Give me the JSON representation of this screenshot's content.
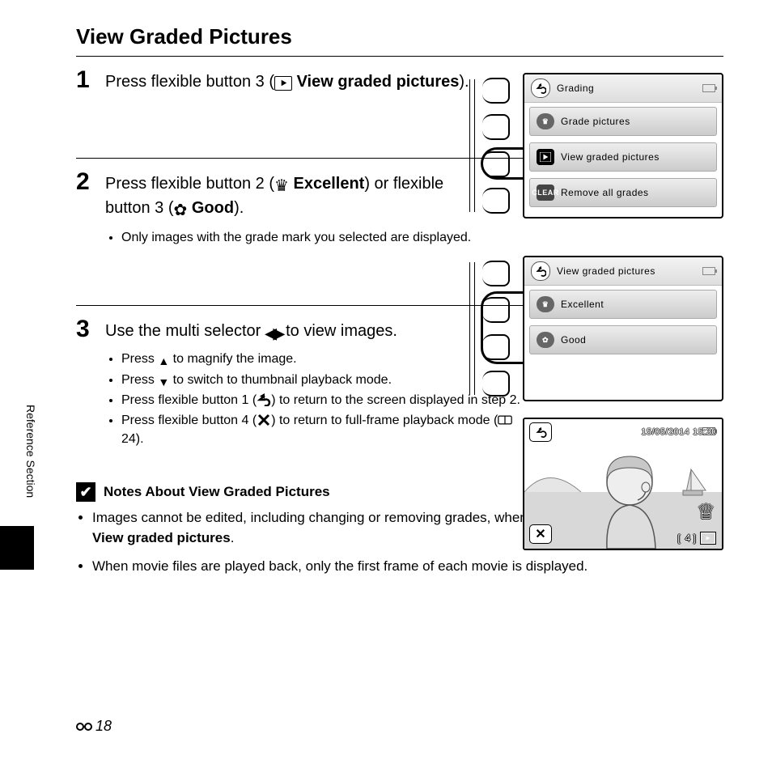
{
  "title": "View Graded Pictures",
  "side_label": "Reference Section",
  "page_number": "18",
  "steps": {
    "s1": {
      "num": "1",
      "pre": "Press flexible button 3 (",
      "bold": "View graded pictures",
      "post": ")."
    },
    "s2": {
      "num": "2",
      "pre": "Press flexible button 2 (",
      "bold1": "Excellent",
      "mid": ") or flexible button 3 (",
      "bold2": "Good",
      "post": ").",
      "bullet": "Only images with the grade mark you selected are displayed."
    },
    "s3": {
      "num": "3",
      "pre": "Use the multi selector ",
      "post": " to view images.",
      "b1a": "Press ",
      "b1b": " to magnify the image.",
      "b2a": "Press ",
      "b2b": " to switch to thumbnail playback mode.",
      "b3a": "Press flexible button 1 (",
      "b3b": ") to return to the screen displayed in step 2.",
      "b4a": "Press flexible button 4 (",
      "b4b": ") to return to full-frame playback mode (",
      "b4c": " 24)."
    }
  },
  "lcd1": {
    "header": "Grading",
    "items": [
      "Grade pictures",
      "View graded pictures",
      "Remove all grades"
    ],
    "clear_label": "CLEAR"
  },
  "lcd2": {
    "header": "View graded pictures",
    "items": [
      "Excellent",
      "Good"
    ]
  },
  "preview": {
    "timestamp": "15/05/2014 15:30",
    "count_prefix": "[",
    "count": "4 ]"
  },
  "notes": {
    "heading": "Notes About View Graded Pictures",
    "n1a": "Images cannot be edited, including changing or removing grades, when they are played back using ",
    "n1b": "View graded pictures",
    "n1c": ".",
    "n2": "When movie files are played back, only the first frame of each movie is displayed."
  }
}
